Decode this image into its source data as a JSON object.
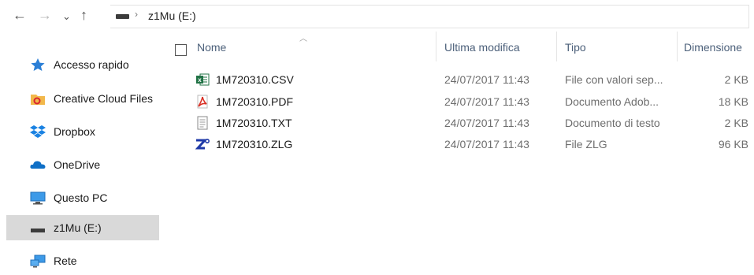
{
  "address_bar": {
    "back": "←",
    "forward": "→",
    "recent": "⌄",
    "up": "↑",
    "separator": "›",
    "path": "z1Mu (E:)"
  },
  "sidebar": {
    "items": [
      {
        "label": "Accesso rapido",
        "icon": "star-icon"
      },
      {
        "label": "Creative Cloud Files",
        "icon": "creative-cloud-icon"
      },
      {
        "label": "Dropbox",
        "icon": "dropbox-icon"
      },
      {
        "label": "OneDrive",
        "icon": "onedrive-icon"
      },
      {
        "label": "Questo PC",
        "icon": "pc-icon"
      },
      {
        "label": "z1Mu (E:)",
        "icon": "drive-icon",
        "selected": true
      },
      {
        "label": "Rete",
        "icon": "network-icon"
      }
    ]
  },
  "columns": {
    "name": "Nome",
    "modified": "Ultima modifica",
    "type": "Tipo",
    "size": "Dimensione"
  },
  "files": [
    {
      "name": "1M720310.CSV",
      "modified": "24/07/2017 11:43",
      "type": "File con valori sep...",
      "size": "2 KB",
      "icon": "excel-csv-icon"
    },
    {
      "name": "1M720310.PDF",
      "modified": "24/07/2017 11:43",
      "type": "Documento Adob...",
      "size": "18 KB",
      "icon": "pdf-icon"
    },
    {
      "name": "1M720310.TXT",
      "modified": "24/07/2017 11:43",
      "type": "Documento di testo",
      "size": "2 KB",
      "icon": "text-file-icon"
    },
    {
      "name": "1M720310.ZLG",
      "modified": "24/07/2017 11:43",
      "type": "File ZLG",
      "size": "96 KB",
      "icon": "zlg-icon"
    }
  ],
  "colors": {
    "header_text": "#4c607a",
    "selected_bg": "#d9d9d9"
  }
}
